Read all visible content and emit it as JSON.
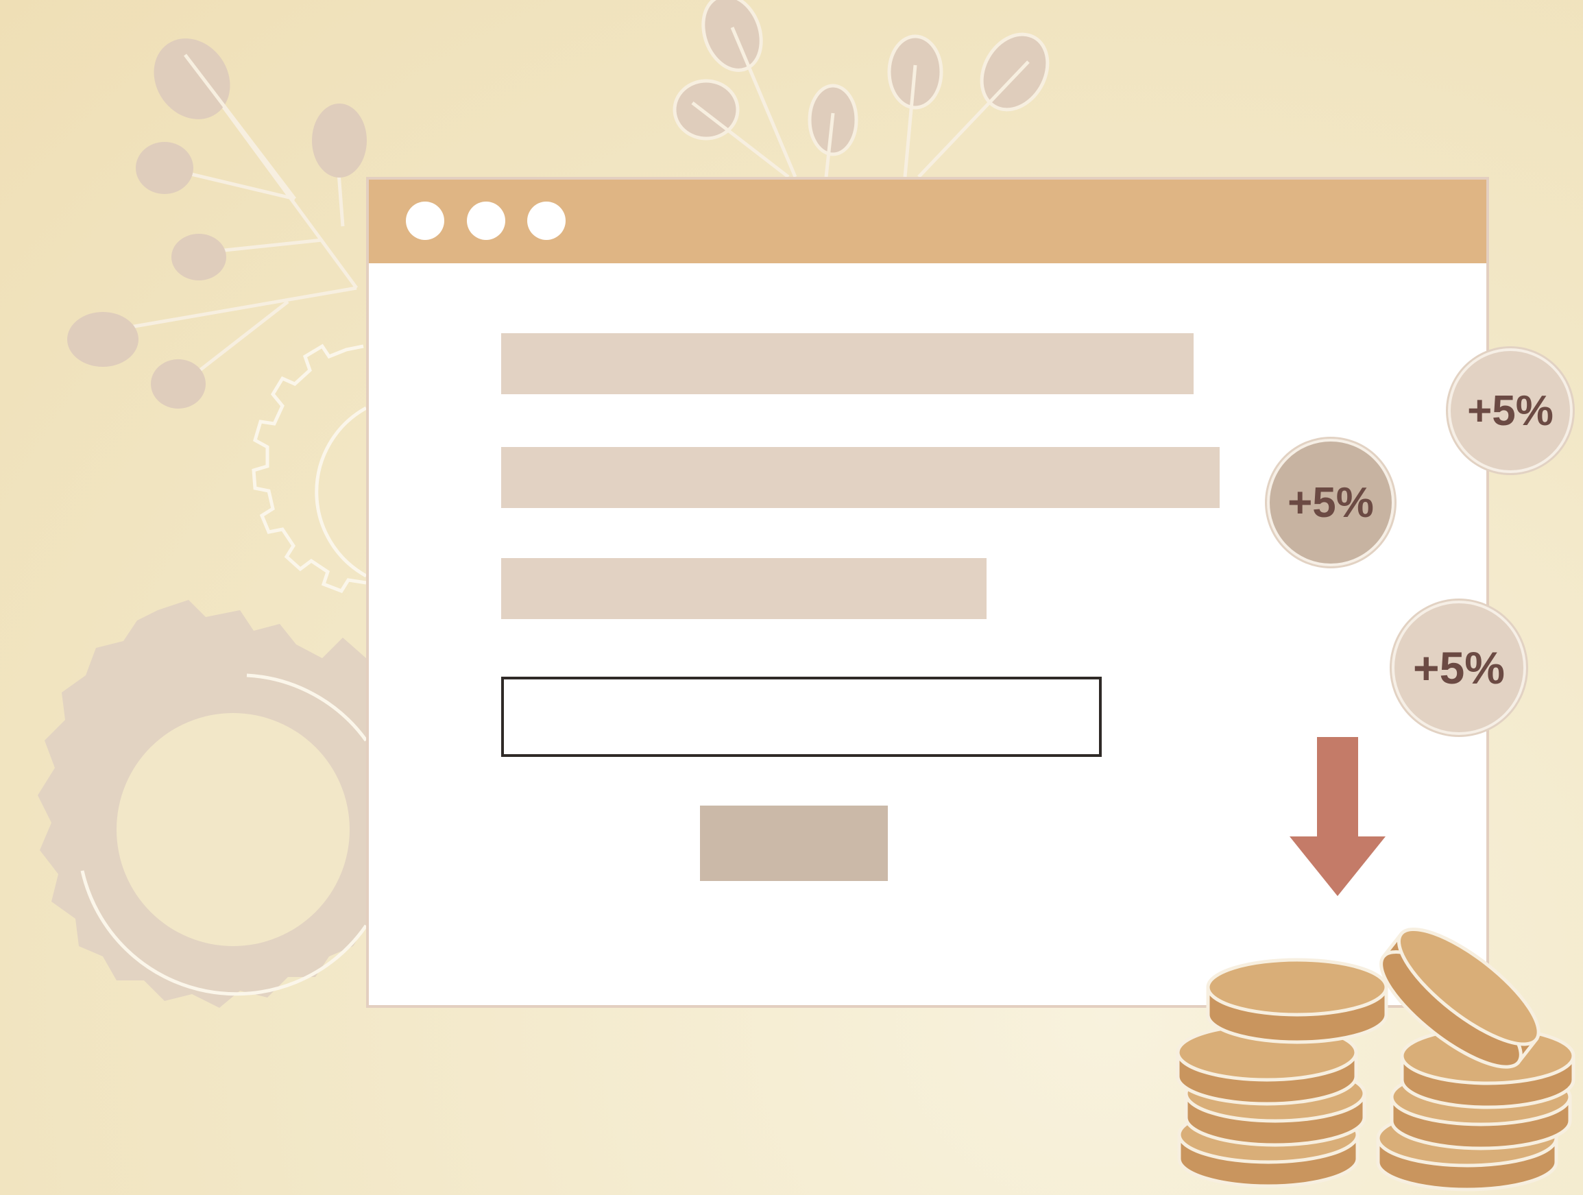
{
  "window": {
    "dots": [
      "",
      "",
      ""
    ],
    "text_lines": [
      "",
      "",
      ""
    ],
    "input": {
      "value": "",
      "placeholder": ""
    },
    "submit": {
      "label": ""
    }
  },
  "badges": [
    {
      "label": "+5%"
    },
    {
      "label": "+5%"
    },
    {
      "label": "+5%"
    }
  ],
  "colors": {
    "background": "#f2e7c6",
    "titlebar": "#dfb584",
    "placeholder_bar": "#e2d2c3",
    "button": "#cbb9a8",
    "arrow": "#c47b68",
    "coin": "#d9ae78",
    "badge_text": "#6b4a43"
  },
  "icons": [
    "leaf-branch-icon",
    "gear-icon",
    "arrow-down-icon",
    "coin-stack-icon"
  ]
}
